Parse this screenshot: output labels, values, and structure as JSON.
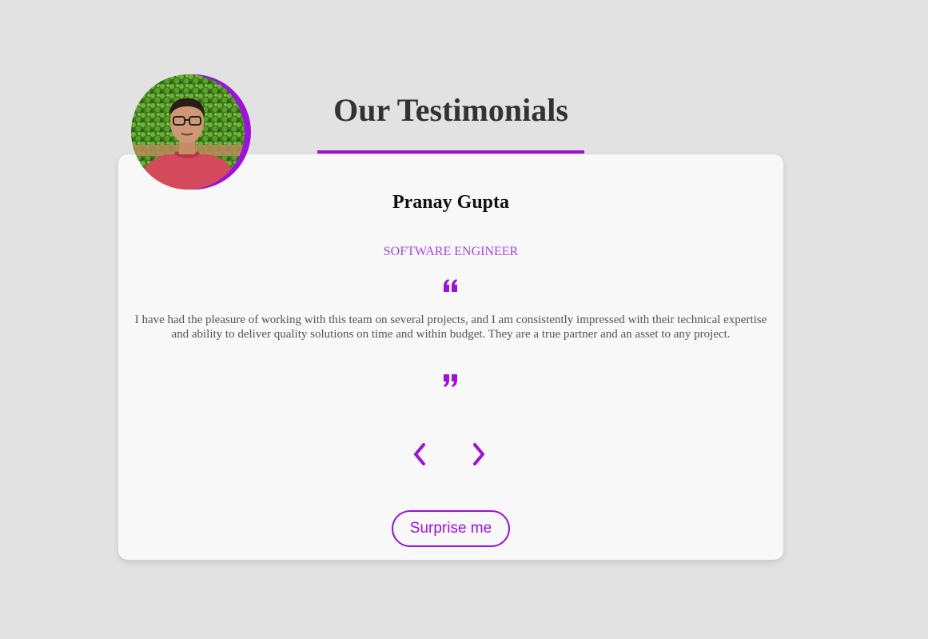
{
  "header": {
    "title": "Our Testimonials"
  },
  "testimonial": {
    "name": "Pranay Gupta",
    "role": "SOFTWARE ENGINEER",
    "text": "I have had the pleasure of working with this team on several projects, and I am consistently impressed with their technical expertise and ability to deliver quality solutions on time and within budget. They are a true partner and an asset to any project."
  },
  "controls": {
    "prev_icon": "chevron-left-icon",
    "next_icon": "chevron-right-icon",
    "surprise_label": "Surprise me"
  },
  "theme": {
    "accent": "#9b12d8",
    "background": "#e2e2e2",
    "card": "#f8f8f8",
    "role_color": "#a447d9"
  }
}
